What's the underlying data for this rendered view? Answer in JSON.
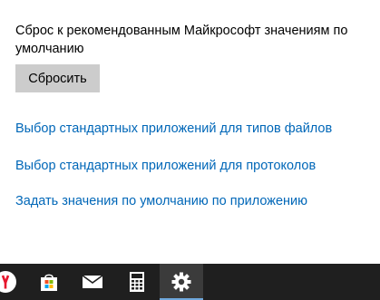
{
  "reset": {
    "description": "Сброс к рекомендованным Майкрософт значениям по умолчанию",
    "button_label": "Сбросить"
  },
  "links": [
    {
      "label": "Выбор стандартных приложений для типов файлов"
    },
    {
      "label": "Выбор стандартных приложений для протоколов"
    },
    {
      "label": "Задать значения по умолчанию по приложению"
    }
  ],
  "taskbar": {
    "items": [
      {
        "icon": "yandex-browser-icon",
        "active": false
      },
      {
        "icon": "microsoft-store-icon",
        "active": false
      },
      {
        "icon": "mail-icon",
        "active": false
      },
      {
        "icon": "calculator-icon",
        "active": false
      },
      {
        "icon": "settings-gear-icon",
        "active": true
      }
    ]
  },
  "colors": {
    "link": "#0067b8",
    "button_bg": "#cccccc",
    "taskbar_bg": "#1f1f1f",
    "active_item_bg": "#3b3b3b",
    "yandex_red": "#e6162d"
  }
}
